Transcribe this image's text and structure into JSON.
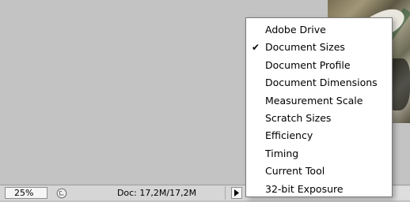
{
  "status_bar": {
    "zoom": "25%",
    "doc_info": "Doc: 17,2M/17,2M"
  },
  "icons": {
    "history": "history-icon",
    "arrow": "triangle-right-icon",
    "check": "check-icon"
  },
  "menu": {
    "items": [
      {
        "label": "Adobe Drive",
        "checked": false
      },
      {
        "label": "Document Sizes",
        "checked": true
      },
      {
        "label": "Document Profile",
        "checked": false
      },
      {
        "label": "Document Dimensions",
        "checked": false
      },
      {
        "label": "Measurement Scale",
        "checked": false
      },
      {
        "label": "Scratch Sizes",
        "checked": false
      },
      {
        "label": "Efficiency",
        "checked": false
      },
      {
        "label": "Timing",
        "checked": false
      },
      {
        "label": "Current Tool",
        "checked": false
      },
      {
        "label": "32-bit Exposure",
        "checked": false
      }
    ],
    "check_mark": "✔"
  }
}
